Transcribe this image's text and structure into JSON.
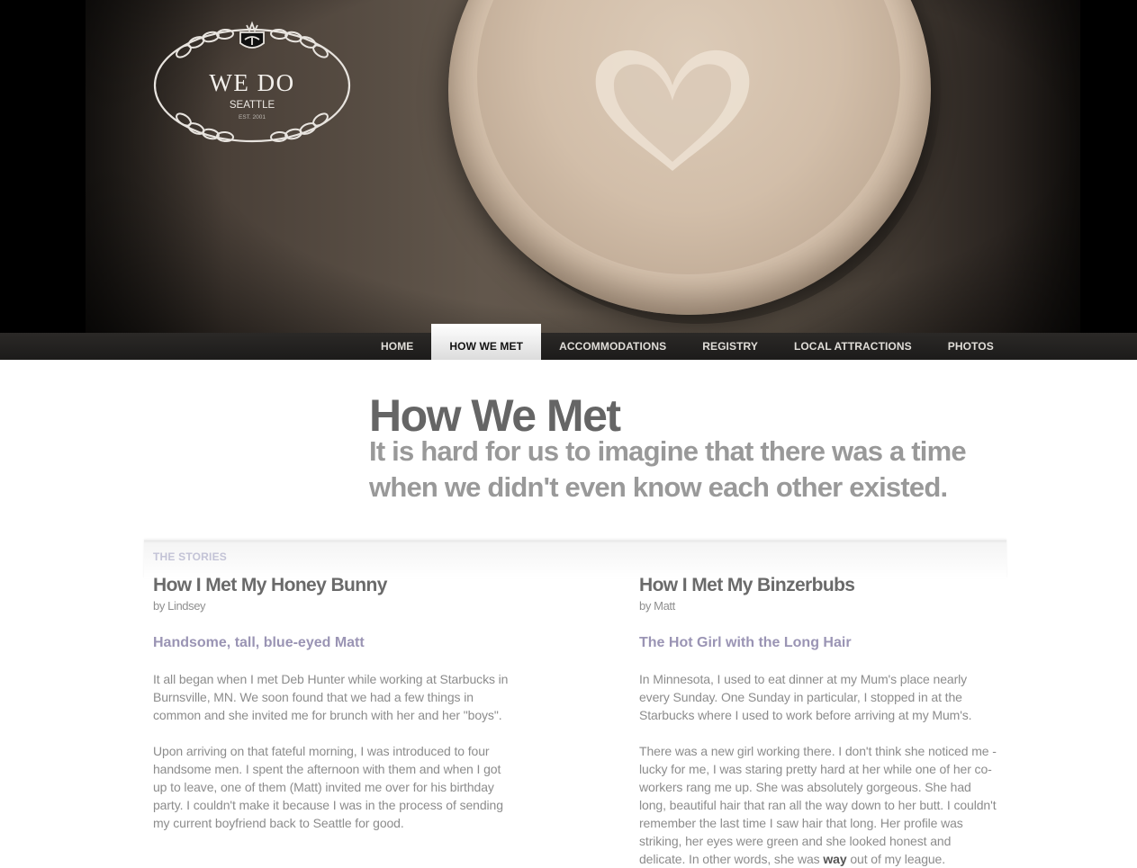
{
  "logo": {
    "title": "WE DO",
    "city": "SEATTLE",
    "established": "EST. 2001"
  },
  "nav": {
    "items": [
      {
        "label": "HOME",
        "active": false
      },
      {
        "label": "HOW WE MET",
        "active": true
      },
      {
        "label": "ACCOMMODATIONS",
        "active": false
      },
      {
        "label": "REGISTRY",
        "active": false
      },
      {
        "label": "LOCAL ATTRACTIONS",
        "active": false
      },
      {
        "label": "PHOTOS",
        "active": false
      }
    ]
  },
  "intro": {
    "title": "How We Met",
    "subtitle": "It is hard for us to imagine that there was a time when we didn't even know each other existed."
  },
  "stories": {
    "section_label": "THE STORIES",
    "left": {
      "title": "How I Met My Honey Bunny",
      "byline": "by Lindsey",
      "heading": "Handsome, tall, blue-eyed Matt",
      "paragraphs": [
        "It all began when I met Deb Hunter while working at Starbucks in Burnsville, MN. We soon found that we had a few things in common and she invited me for brunch with her and her \"boys\".",
        "Upon arriving on that fateful morning, I was introduced to four handsome men. I spent the afternoon with them and when I got up to leave, one of them (Matt) invited me over for his birthday party. I couldn't make it because I was in the process of sending my current boyfriend back to Seattle for good."
      ]
    },
    "right": {
      "title": "How I Met My Binzerbubs",
      "byline": "by Matt",
      "heading": "The Hot Girl with the Long Hair",
      "paragraph1": "In Minnesota, I used to eat dinner at my Mum's place nearly every Sunday. One Sunday in particular, I stopped in at the Starbucks where I used to work before arriving at my Mum's.",
      "paragraph2_start": "There was a new girl working there. I don't think she noticed me - lucky for me, I was staring pretty hard at her while one of her co-workers rang me up. She was absolutely gorgeous. She had long, beautiful hair that ran all the way down to her butt. I couldn't remember the last time I saw hair that long. Her profile was striking, her eyes were green and she looked honest and delicate. In other words, she was ",
      "paragraph2_emphasis": "way",
      "paragraph2_end": " out of my league."
    }
  }
}
